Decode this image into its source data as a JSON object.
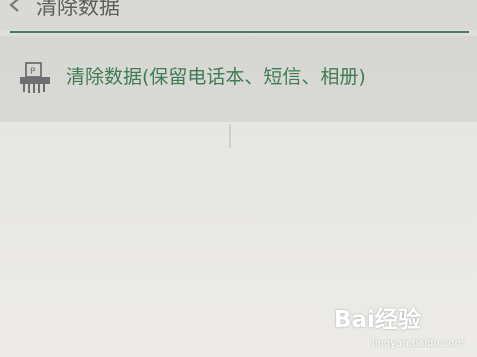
{
  "header": {
    "title": "清除数据"
  },
  "setting_item": {
    "label": "清除数据(保留电话本、短信、相册)"
  },
  "watermark": {
    "brand": "Bai经验",
    "url": "jingyan.baidu.com"
  }
}
